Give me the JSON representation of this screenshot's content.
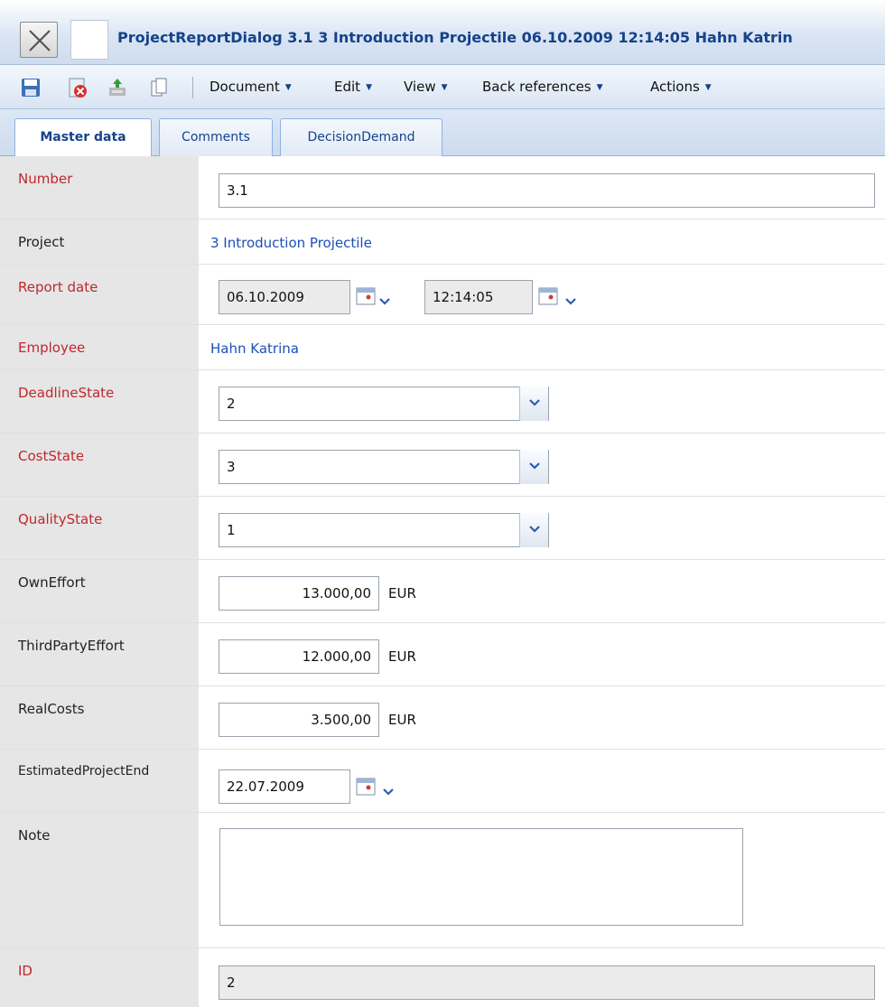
{
  "window": {
    "title": "ProjectReportDialog 3.1 3 Introduction Projectile 06.10.2009 12:14:05 Hahn Katrin"
  },
  "toolbar": {
    "icons": [
      "save-icon",
      "delete-icon",
      "export-icon",
      "copy-icon"
    ],
    "menus": [
      "Document",
      "Edit",
      "View",
      "Back references",
      "Actions"
    ]
  },
  "tabs": [
    "Master data",
    "Comments",
    "DecisionDemand"
  ],
  "form": {
    "number_label": "Number",
    "number_value": "3.1",
    "project_label": "Project",
    "project_value": "3 Introduction Projectile",
    "report_date_label": "Report date",
    "report_date_value": "06.10.2009",
    "report_time_value": "12:14:05",
    "employee_label": "Employee",
    "employee_value": "Hahn Katrina",
    "deadline_state_label": "DeadlineState",
    "deadline_state_value": "2",
    "cost_state_label": "CostState",
    "cost_state_value": "3",
    "quality_state_label": "QualityState",
    "quality_state_value": "1",
    "own_effort_label": "OwnEffort",
    "own_effort_value": "13.000,00",
    "third_party_effort_label": "ThirdPartyEffort",
    "third_party_effort_value": "12.000,00",
    "real_costs_label": "RealCosts",
    "real_costs_value": "3.500,00",
    "currency": "EUR",
    "estimated_end_label": "EstimatedProjectEnd",
    "estimated_end_value": "22.07.2009",
    "note_label": "Note",
    "note_value": "",
    "id_label": "ID",
    "id_value": "2"
  },
  "colors": {
    "required_label": "#c0272d",
    "link": "#1b4fb8",
    "title_text": "#15428b",
    "label_column_bg": "#e6e6e6"
  }
}
